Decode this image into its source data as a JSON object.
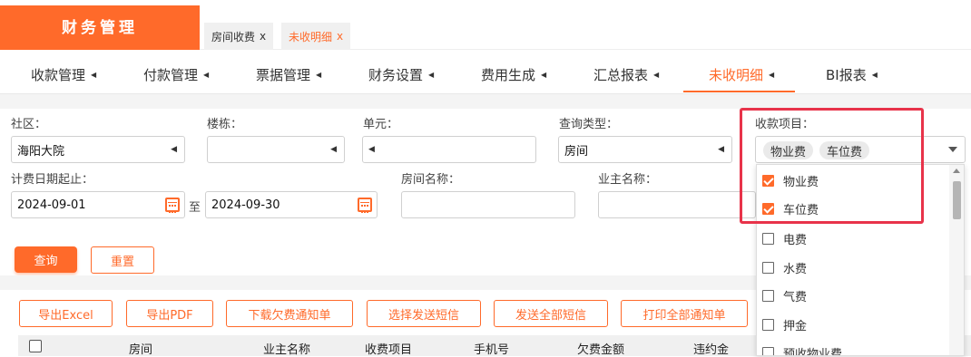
{
  "app": {
    "title": "财务管理"
  },
  "tabs": [
    {
      "label": "房间收费",
      "close": "x"
    },
    {
      "label": "未收明细",
      "close": "x"
    }
  ],
  "nav": [
    {
      "label": "收款管理"
    },
    {
      "label": "付款管理"
    },
    {
      "label": "票据管理"
    },
    {
      "label": "财务设置"
    },
    {
      "label": "费用生成"
    },
    {
      "label": "汇总报表"
    },
    {
      "label": "未收明细"
    },
    {
      "label": "BI报表"
    }
  ],
  "filters": {
    "community_label": "社区：",
    "community_value": "海阳大院",
    "building_label": "楼栋：",
    "building_value": "",
    "unit_label": "单元：",
    "unit_value": "",
    "query_type_label": "查询类型：",
    "query_type_value": "房间",
    "fee_item_label": "收款项目：",
    "date_range_label": "计费日期起止：",
    "date_from": "2024-09-01",
    "to_label": "至",
    "date_to": "2024-09-30",
    "room_name_label": "房间名称：",
    "owner_name_label": "业主名称："
  },
  "fee_items": {
    "selected": [
      "物业费",
      "车位费"
    ]
  },
  "dropdown": {
    "options": [
      {
        "label": "物业费",
        "checked": true
      },
      {
        "label": "车位费",
        "checked": true
      },
      {
        "label": "电费",
        "checked": false
      },
      {
        "label": "水费",
        "checked": false
      },
      {
        "label": "气费",
        "checked": false
      },
      {
        "label": "押金",
        "checked": false
      },
      {
        "label": "预收物业费",
        "checked": false
      }
    ]
  },
  "buttons": {
    "query": "查询",
    "reset": "重置",
    "export_excel": "导出Excel",
    "export_pdf": "导出PDF",
    "download_notice": "下载欠费通知单",
    "select_sms": "选择发送短信",
    "send_all_sms": "发送全部短信",
    "print_all": "打印全部通知单"
  },
  "table": {
    "columns": [
      "房间",
      "业主名称",
      "收费项目",
      "手机号",
      "欠费金额",
      "违约金"
    ]
  },
  "colors": {
    "accent": "#ff6a2a",
    "highlight": "#e8334a"
  }
}
